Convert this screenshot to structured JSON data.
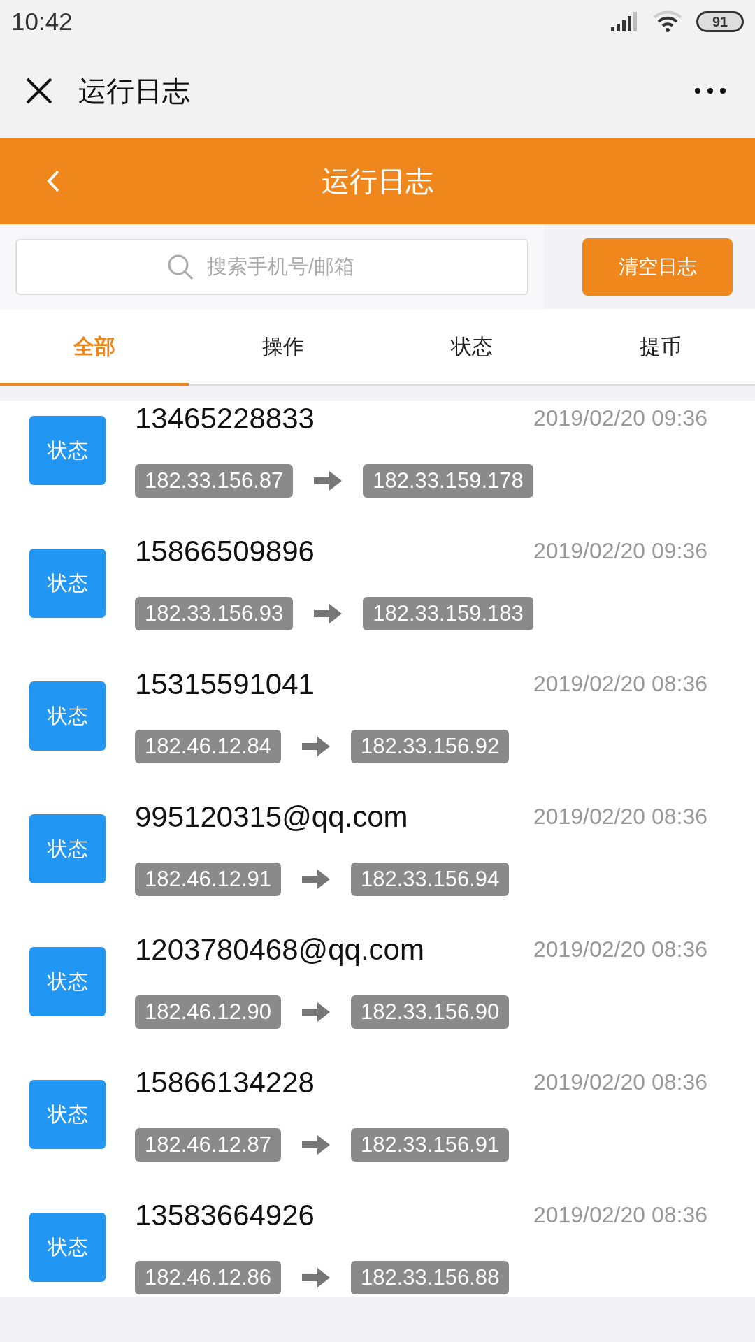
{
  "status_bar": {
    "time": "10:42",
    "battery": "91"
  },
  "title_bar": {
    "title": "运行日志"
  },
  "header": {
    "title": "运行日志"
  },
  "search": {
    "placeholder": "搜索手机号/邮箱"
  },
  "clear_button": "清空日志",
  "tabs": [
    {
      "label": "全部",
      "selected": true
    },
    {
      "label": "操作",
      "selected": false
    },
    {
      "label": "状态",
      "selected": false
    },
    {
      "label": "提币",
      "selected": false
    }
  ],
  "logs": [
    {
      "badge": "状态",
      "account": "13465228833",
      "time": "2019/02/20 09:36",
      "from_ip": "182.33.156.87",
      "to_ip": "182.33.159.178"
    },
    {
      "badge": "状态",
      "account": "15866509896",
      "time": "2019/02/20 09:36",
      "from_ip": "182.33.156.93",
      "to_ip": "182.33.159.183"
    },
    {
      "badge": "状态",
      "account": "15315591041",
      "time": "2019/02/20 08:36",
      "from_ip": "182.46.12.84",
      "to_ip": "182.33.156.92"
    },
    {
      "badge": "状态",
      "account": "995120315@qq.com",
      "time": "2019/02/20 08:36",
      "from_ip": "182.46.12.91",
      "to_ip": "182.33.156.94"
    },
    {
      "badge": "状态",
      "account": "1203780468@qq.com",
      "time": "2019/02/20 08:36",
      "from_ip": "182.46.12.90",
      "to_ip": "182.33.156.90"
    },
    {
      "badge": "状态",
      "account": "15866134228",
      "time": "2019/02/20 08:36",
      "from_ip": "182.46.12.87",
      "to_ip": "182.33.156.91"
    },
    {
      "badge": "状态",
      "account": "13583664926",
      "time": "2019/02/20 08:36",
      "from_ip": "182.46.12.86",
      "to_ip": "182.33.156.88"
    }
  ]
}
